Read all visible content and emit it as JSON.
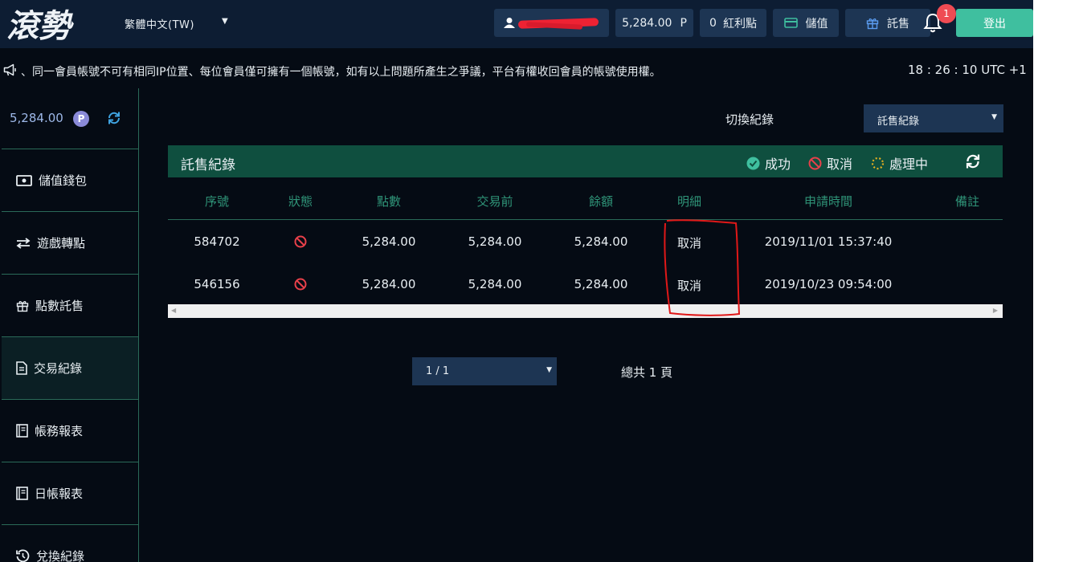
{
  "header": {
    "logo_text": "滾勢",
    "language": "繁體中文(TW)",
    "points_label": "5,284.00",
    "points_unit": "P",
    "bonus_count": "0",
    "bonus_label": "紅利點",
    "deposit_label": "儲值",
    "consign_label": "託售",
    "notification_count": "1",
    "logout_label": "登出",
    "colors": {
      "bar": "#0d1d33",
      "button": "#1d3553",
      "logout": "#3fbf9f",
      "badge": "#ef4b53"
    }
  },
  "announcement": {
    "text": "、同一會員帳號不可有相同IP位置、每位會員僅可擁有一個帳號，如有以上問題所產生之爭議，平台有權收回會員的帳號使用權。",
    "clock": "18 : 26 : 10 UTC +1"
  },
  "sidebar": {
    "balance": "5,284.00",
    "currency_badge": "P",
    "items": [
      {
        "label": "儲值錢包",
        "icon": "wallet-icon"
      },
      {
        "label": "遊戲轉點",
        "icon": "transfer-icon"
      },
      {
        "label": "點數託售",
        "icon": "gift-icon"
      },
      {
        "label": "交易紀錄",
        "icon": "document-icon"
      },
      {
        "label": "帳務報表",
        "icon": "report-icon"
      },
      {
        "label": "日帳報表",
        "icon": "daily-report-icon"
      },
      {
        "label": "兌換紀錄",
        "icon": "history-icon"
      }
    ]
  },
  "filter": {
    "label": "切換紀錄",
    "selected": "託售紀錄"
  },
  "panel": {
    "title": "託售紀錄",
    "legend": {
      "success": "成功",
      "cancel": "取消",
      "processing": "處理中"
    },
    "columns": [
      "序號",
      "狀態",
      "點數",
      "交易前",
      "餘額",
      "明細",
      "申請時間",
      "備註"
    ],
    "rows": [
      {
        "id": "584702",
        "status": "cancel-icon",
        "points": "5,284.00",
        "before": "5,284.00",
        "balance": "5,284.00",
        "detail": "取消",
        "time": "2019/11/01 15:37:40",
        "note": ""
      },
      {
        "id": "546156",
        "status": "cancel-icon",
        "points": "5,284.00",
        "before": "5,284.00",
        "balance": "5,284.00",
        "detail": "取消",
        "time": "2019/10/23 09:54:00",
        "note": ""
      }
    ]
  },
  "pagination": {
    "selected": "1 / 1",
    "total": "總共 1 頁"
  }
}
